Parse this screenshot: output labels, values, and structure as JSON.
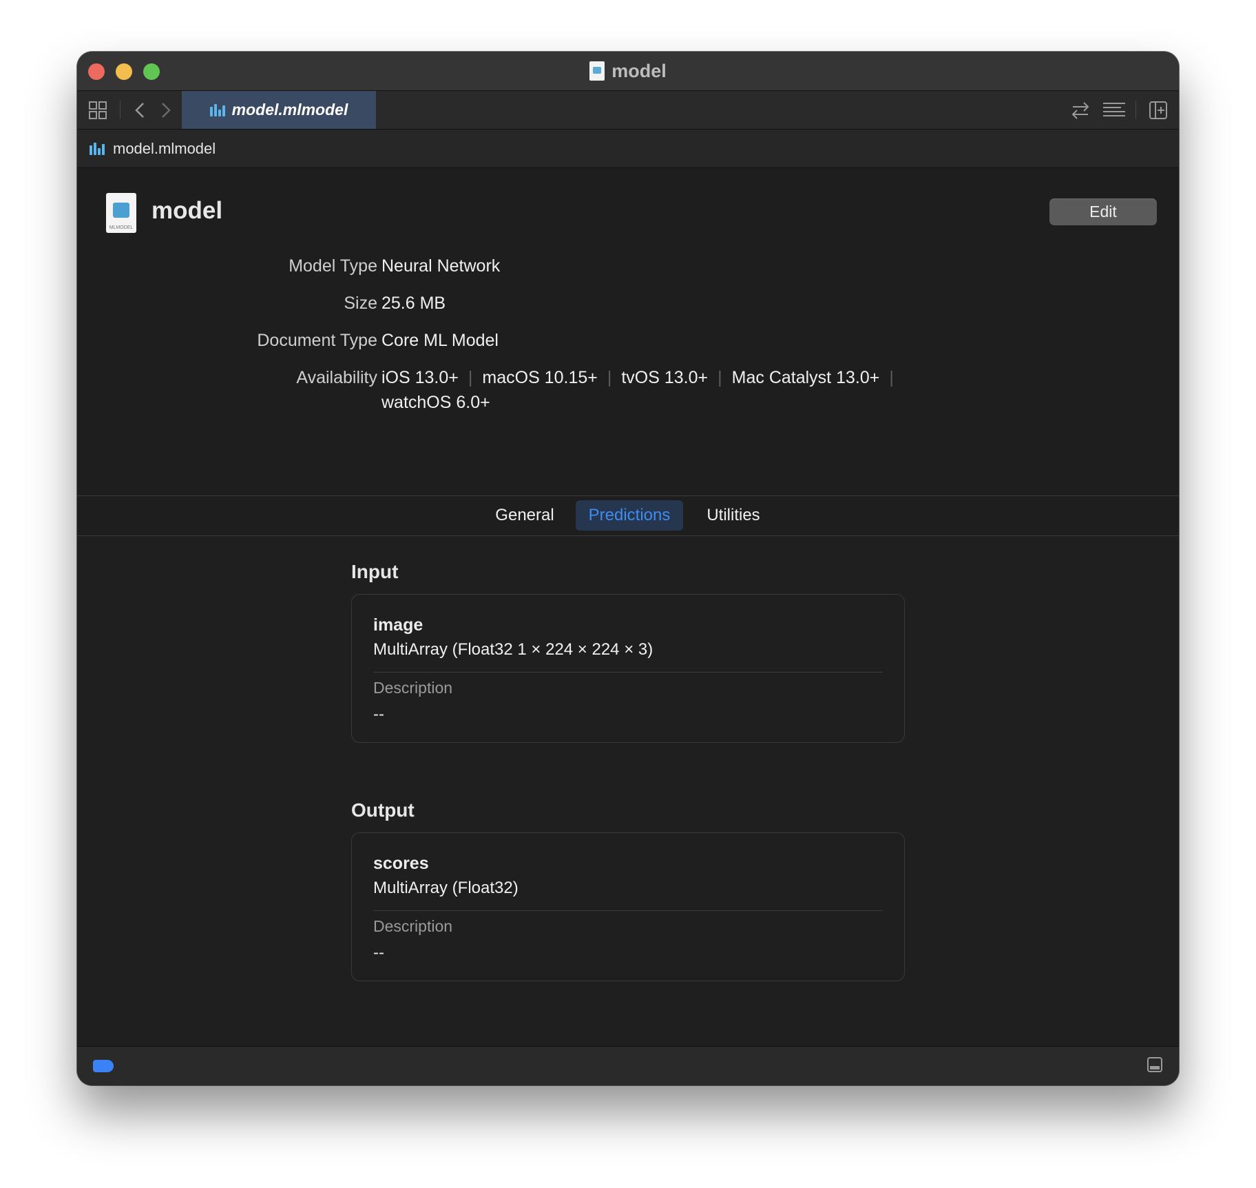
{
  "window": {
    "title": "model"
  },
  "tabbar": {
    "active_tab": "model.mlmodel",
    "icons": [
      "grid-icon",
      "chevron-left-icon",
      "chevron-right-icon",
      "swap-arrows-icon",
      "lines-icon",
      "add-editor-icon"
    ]
  },
  "breadcrumb": {
    "label": "model.mlmodel"
  },
  "header": {
    "model_name": "model",
    "edit_label": "Edit",
    "icon_caption": "MLMODEL",
    "properties": [
      {
        "label": "Model Type",
        "value": "Neural Network"
      },
      {
        "label": "Size",
        "value": "25.6 MB"
      },
      {
        "label": "Document Type",
        "value": "Core ML Model"
      }
    ],
    "availability": {
      "label": "Availability",
      "line1": [
        "iOS 13.0+",
        "macOS 10.15+",
        "tvOS 13.0+",
        "Mac Catalyst 13.0+"
      ],
      "line2": "watchOS 6.0+",
      "separator": "|"
    }
  },
  "segments": {
    "general": "General",
    "predictions": "Predictions",
    "utilities": "Utilities",
    "active": "predictions"
  },
  "input": {
    "title": "Input",
    "name": "image",
    "type": "MultiArray (Float32 1 × 224 × 224 × 3)",
    "description_label": "Description",
    "description_value": "--"
  },
  "output": {
    "title": "Output",
    "name": "scores",
    "type": "MultiArray (Float32)",
    "description_label": "Description",
    "description_value": "--"
  },
  "colors": {
    "accent": "#3f8cf0",
    "window_bg": "#1f1f1f",
    "active_tab_bg": "#3b4a63"
  }
}
